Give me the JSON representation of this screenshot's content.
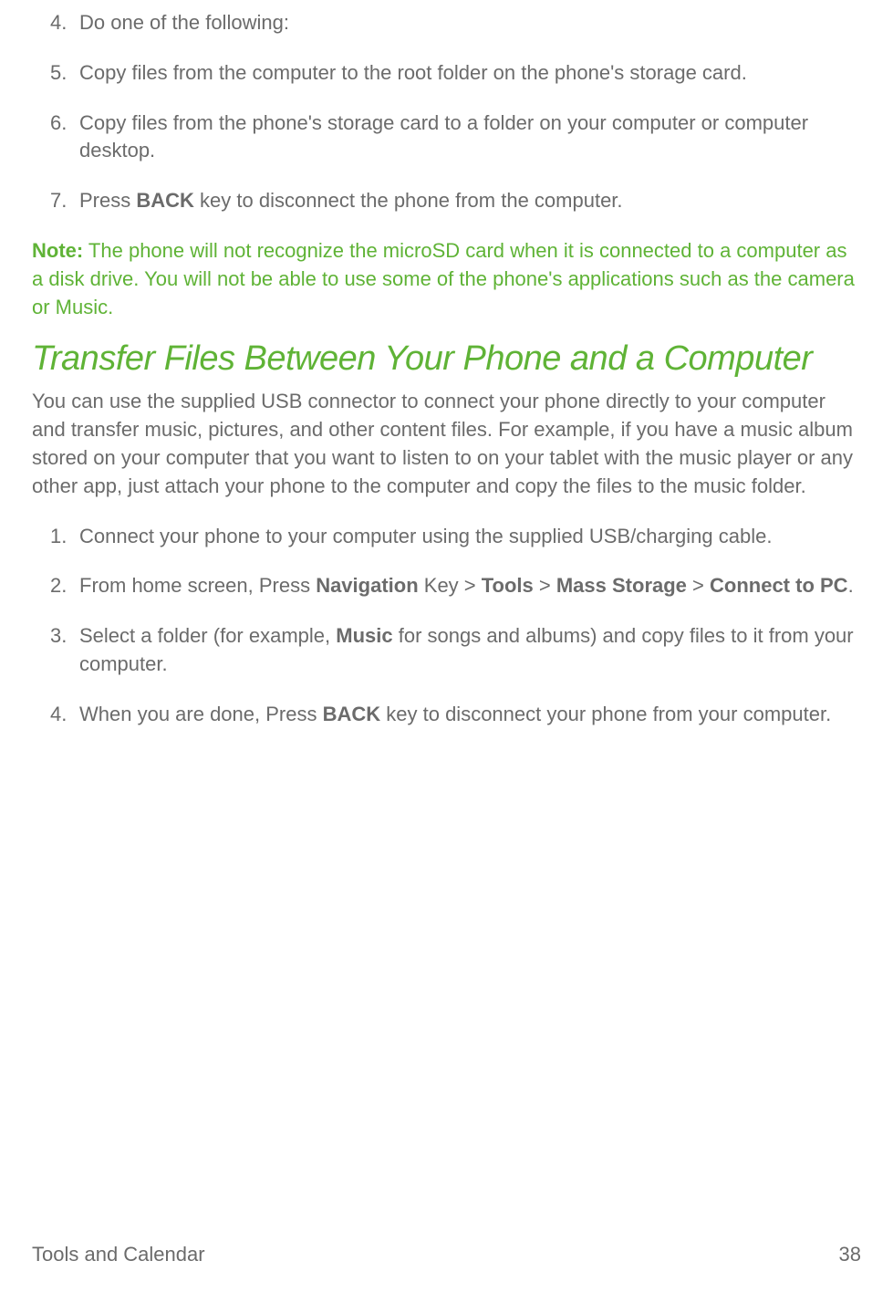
{
  "list1": {
    "items": [
      {
        "num": "4.",
        "segments": [
          {
            "t": "Do one of the following:"
          }
        ]
      },
      {
        "num": "5.",
        "segments": [
          {
            "t": "Copy files from the computer to the root folder on the phone's storage card."
          }
        ]
      },
      {
        "num": "6.",
        "segments": [
          {
            "t": "Copy files from the phone's storage card to a folder on your computer or computer desktop."
          }
        ]
      },
      {
        "num": "7.",
        "segments": [
          {
            "t": "Press "
          },
          {
            "t": "BACK",
            "b": true
          },
          {
            "t": " key to disconnect the phone from the computer."
          }
        ]
      }
    ]
  },
  "note": {
    "label": "Note:",
    "text": " The phone will not recognize the microSD card when it is connected to a computer as a disk drive. You will not be able to use some of the phone's applications such as the camera or Music."
  },
  "heading": "Transfer Files Between Your Phone and a Computer",
  "intro": "You can use the supplied USB connector to connect your phone directly to your computer and transfer music, pictures, and other content files. For example, if you have a music album stored on your computer that you want to listen to on your tablet with the music player or any other app, just attach your phone to the computer and copy the files to the music folder.",
  "list2": {
    "items": [
      {
        "num": "1.",
        "segments": [
          {
            "t": "Connect your phone to your computer using the supplied USB/charging cable."
          }
        ]
      },
      {
        "num": "2.",
        "segments": [
          {
            "t": "From home screen, Press "
          },
          {
            "t": "Navigation",
            "b": true
          },
          {
            "t": " Key > "
          },
          {
            "t": "Tools",
            "b": true
          },
          {
            "t": " > "
          },
          {
            "t": "Mass Storage",
            "b": true
          },
          {
            "t": " > "
          },
          {
            "t": "Connect to PC",
            "b": true
          },
          {
            "t": "."
          }
        ]
      },
      {
        "num": "3.",
        "segments": [
          {
            "t": "Select a folder (for example, "
          },
          {
            "t": "Music",
            "b": true
          },
          {
            "t": " for songs and albums) and copy files to it from your computer."
          }
        ]
      },
      {
        "num": "4.",
        "segments": [
          {
            "t": "When you are done, Press "
          },
          {
            "t": "BACK",
            "b": true
          },
          {
            "t": " key to disconnect your phone from your computer."
          }
        ]
      }
    ]
  },
  "footer": {
    "left": "Tools and Calendar",
    "right": "38"
  }
}
